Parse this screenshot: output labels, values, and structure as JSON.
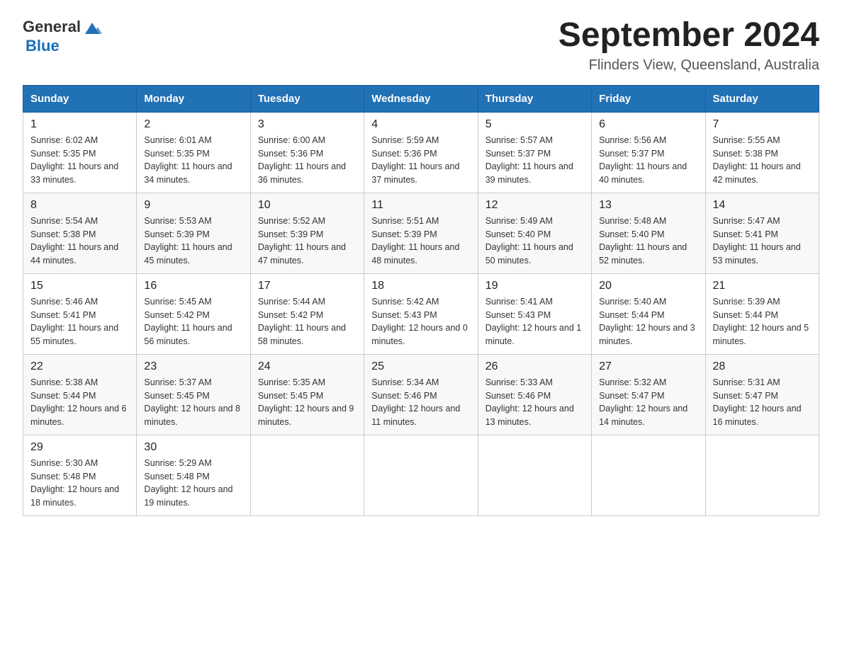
{
  "header": {
    "logo": {
      "general": "General",
      "blue": "Blue"
    },
    "month_title": "September 2024",
    "location": "Flinders View, Queensland, Australia"
  },
  "days_of_week": [
    "Sunday",
    "Monday",
    "Tuesday",
    "Wednesday",
    "Thursday",
    "Friday",
    "Saturday"
  ],
  "weeks": [
    [
      {
        "day": "1",
        "sunrise": "6:02 AM",
        "sunset": "5:35 PM",
        "daylight": "11 hours and 33 minutes."
      },
      {
        "day": "2",
        "sunrise": "6:01 AM",
        "sunset": "5:35 PM",
        "daylight": "11 hours and 34 minutes."
      },
      {
        "day": "3",
        "sunrise": "6:00 AM",
        "sunset": "5:36 PM",
        "daylight": "11 hours and 36 minutes."
      },
      {
        "day": "4",
        "sunrise": "5:59 AM",
        "sunset": "5:36 PM",
        "daylight": "11 hours and 37 minutes."
      },
      {
        "day": "5",
        "sunrise": "5:57 AM",
        "sunset": "5:37 PM",
        "daylight": "11 hours and 39 minutes."
      },
      {
        "day": "6",
        "sunrise": "5:56 AM",
        "sunset": "5:37 PM",
        "daylight": "11 hours and 40 minutes."
      },
      {
        "day": "7",
        "sunrise": "5:55 AM",
        "sunset": "5:38 PM",
        "daylight": "11 hours and 42 minutes."
      }
    ],
    [
      {
        "day": "8",
        "sunrise": "5:54 AM",
        "sunset": "5:38 PM",
        "daylight": "11 hours and 44 minutes."
      },
      {
        "day": "9",
        "sunrise": "5:53 AM",
        "sunset": "5:39 PM",
        "daylight": "11 hours and 45 minutes."
      },
      {
        "day": "10",
        "sunrise": "5:52 AM",
        "sunset": "5:39 PM",
        "daylight": "11 hours and 47 minutes."
      },
      {
        "day": "11",
        "sunrise": "5:51 AM",
        "sunset": "5:39 PM",
        "daylight": "11 hours and 48 minutes."
      },
      {
        "day": "12",
        "sunrise": "5:49 AM",
        "sunset": "5:40 PM",
        "daylight": "11 hours and 50 minutes."
      },
      {
        "day": "13",
        "sunrise": "5:48 AM",
        "sunset": "5:40 PM",
        "daylight": "11 hours and 52 minutes."
      },
      {
        "day": "14",
        "sunrise": "5:47 AM",
        "sunset": "5:41 PM",
        "daylight": "11 hours and 53 minutes."
      }
    ],
    [
      {
        "day": "15",
        "sunrise": "5:46 AM",
        "sunset": "5:41 PM",
        "daylight": "11 hours and 55 minutes."
      },
      {
        "day": "16",
        "sunrise": "5:45 AM",
        "sunset": "5:42 PM",
        "daylight": "11 hours and 56 minutes."
      },
      {
        "day": "17",
        "sunrise": "5:44 AM",
        "sunset": "5:42 PM",
        "daylight": "11 hours and 58 minutes."
      },
      {
        "day": "18",
        "sunrise": "5:42 AM",
        "sunset": "5:43 PM",
        "daylight": "12 hours and 0 minutes."
      },
      {
        "day": "19",
        "sunrise": "5:41 AM",
        "sunset": "5:43 PM",
        "daylight": "12 hours and 1 minute."
      },
      {
        "day": "20",
        "sunrise": "5:40 AM",
        "sunset": "5:44 PM",
        "daylight": "12 hours and 3 minutes."
      },
      {
        "day": "21",
        "sunrise": "5:39 AM",
        "sunset": "5:44 PM",
        "daylight": "12 hours and 5 minutes."
      }
    ],
    [
      {
        "day": "22",
        "sunrise": "5:38 AM",
        "sunset": "5:44 PM",
        "daylight": "12 hours and 6 minutes."
      },
      {
        "day": "23",
        "sunrise": "5:37 AM",
        "sunset": "5:45 PM",
        "daylight": "12 hours and 8 minutes."
      },
      {
        "day": "24",
        "sunrise": "5:35 AM",
        "sunset": "5:45 PM",
        "daylight": "12 hours and 9 minutes."
      },
      {
        "day": "25",
        "sunrise": "5:34 AM",
        "sunset": "5:46 PM",
        "daylight": "12 hours and 11 minutes."
      },
      {
        "day": "26",
        "sunrise": "5:33 AM",
        "sunset": "5:46 PM",
        "daylight": "12 hours and 13 minutes."
      },
      {
        "day": "27",
        "sunrise": "5:32 AM",
        "sunset": "5:47 PM",
        "daylight": "12 hours and 14 minutes."
      },
      {
        "day": "28",
        "sunrise": "5:31 AM",
        "sunset": "5:47 PM",
        "daylight": "12 hours and 16 minutes."
      }
    ],
    [
      {
        "day": "29",
        "sunrise": "5:30 AM",
        "sunset": "5:48 PM",
        "daylight": "12 hours and 18 minutes."
      },
      {
        "day": "30",
        "sunrise": "5:29 AM",
        "sunset": "5:48 PM",
        "daylight": "12 hours and 19 minutes."
      },
      null,
      null,
      null,
      null,
      null
    ]
  ]
}
